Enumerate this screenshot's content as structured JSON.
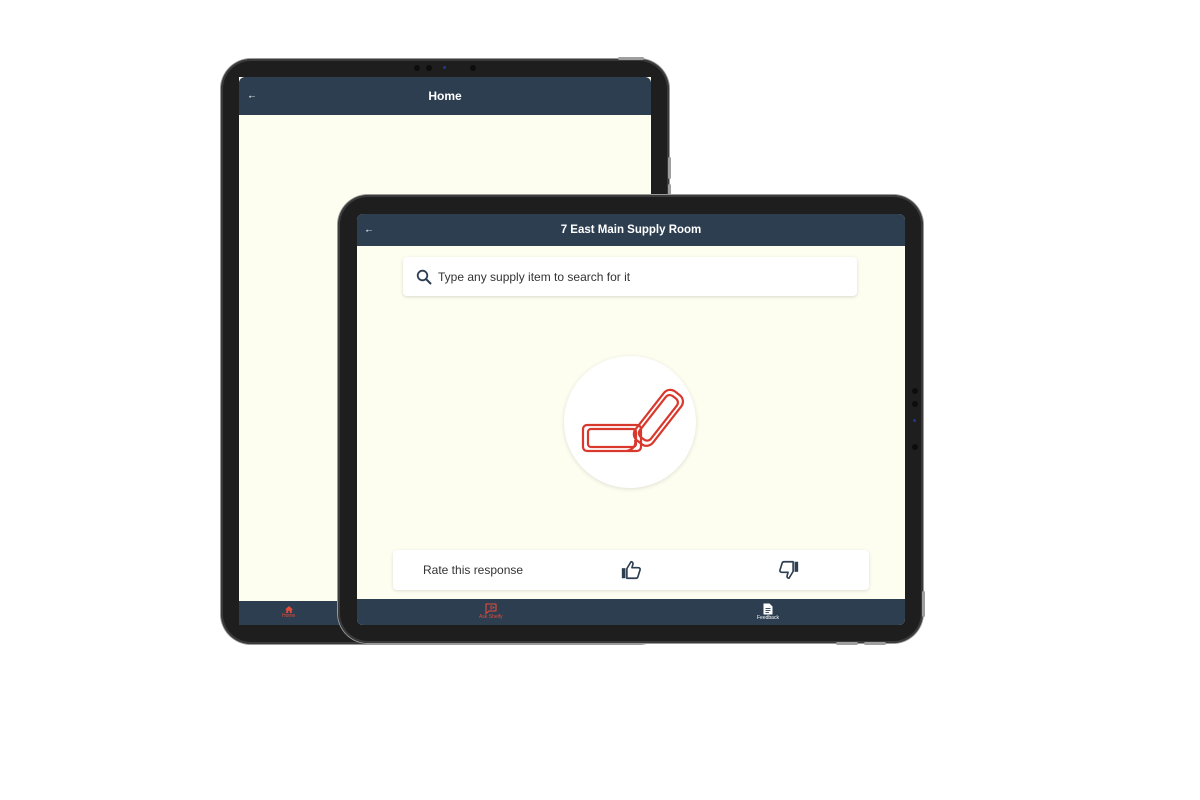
{
  "back_tablet": {
    "header": {
      "back_icon": "arrow-left-icon",
      "title": "Home"
    },
    "bottom_nav": [
      {
        "label": "Home",
        "icon": "home-icon",
        "active": true
      }
    ]
  },
  "front_tablet": {
    "header": {
      "back_icon": "arrow-left-icon",
      "title": "7 East Main Supply Room"
    },
    "search": {
      "icon": "search-icon",
      "placeholder": "Type any supply item to search for it"
    },
    "result_image": {
      "icon": "paperclip-icon"
    },
    "rating": {
      "label": "Rate this response",
      "thumbs_up_icon": "thumbs-up-icon",
      "thumbs_down_icon": "thumbs-down-icon"
    },
    "bottom_nav": [
      {
        "label": "Ask Shelfy",
        "icon": "chat-icon",
        "active": true
      },
      {
        "label": "Feedback",
        "icon": "document-icon",
        "active": false
      }
    ]
  },
  "colors": {
    "header_bg": "#2c3e50",
    "screen_bg": "#fdfdf0",
    "accent_red": "#e24c3b",
    "device_frame": "#1e1e1e"
  }
}
